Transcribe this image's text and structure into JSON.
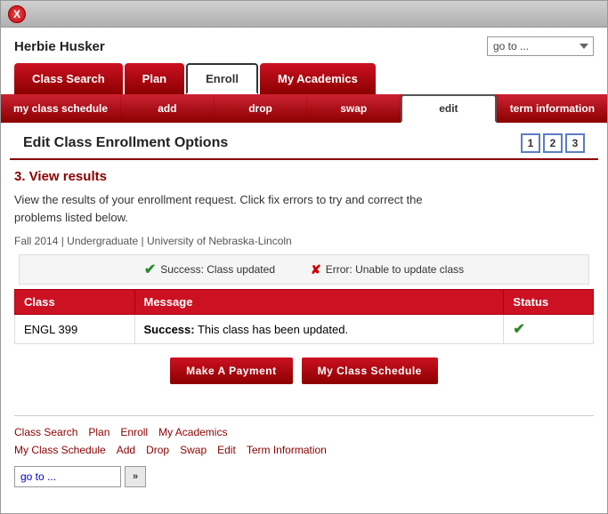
{
  "window": {
    "close_button": "X"
  },
  "header": {
    "user_name": "Herbie Husker",
    "goto_label": "go to ...",
    "goto_placeholder": "go to ..."
  },
  "main_nav": {
    "tabs": [
      {
        "id": "class-search",
        "label": "Class Search",
        "active": false
      },
      {
        "id": "plan",
        "label": "Plan",
        "active": false
      },
      {
        "id": "enroll",
        "label": "Enroll",
        "active": true
      },
      {
        "id": "my-academics",
        "label": "My Academics",
        "active": false
      }
    ]
  },
  "sub_nav": {
    "tabs": [
      {
        "id": "my-class-schedule",
        "label": "my class schedule",
        "active": false
      },
      {
        "id": "add",
        "label": "add",
        "active": false
      },
      {
        "id": "drop",
        "label": "drop",
        "active": false
      },
      {
        "id": "swap",
        "label": "swap",
        "active": false
      },
      {
        "id": "edit",
        "label": "edit",
        "active": true
      },
      {
        "id": "term-information",
        "label": "term information",
        "active": false
      }
    ]
  },
  "page": {
    "title": "Edit Class Enrollment Options",
    "steps": [
      "1",
      "2",
      "3"
    ],
    "section_header": "3.  View results",
    "description_line1": "View the results of your enrollment request.  Click fix errors to try and correct the",
    "description_line2": "problems listed below.",
    "term_info": "Fall 2014 | Undergraduate | University of Nebraska-Lincoln"
  },
  "status_bar": {
    "success_label": "Success:  Class updated",
    "error_label": "Error: Unable to update class"
  },
  "results_table": {
    "headers": [
      "Class",
      "Message",
      "Status"
    ],
    "rows": [
      {
        "class": "ENGL  399",
        "message_bold": "Success:",
        "message_text": " This class has been updated.",
        "status": "✓"
      }
    ]
  },
  "buttons": {
    "make_payment": "Make A Payment",
    "my_class_schedule": "My Class Schedule"
  },
  "footer": {
    "links_row1": [
      {
        "id": "class-search",
        "label": "Class Search"
      },
      {
        "id": "plan",
        "label": "Plan"
      },
      {
        "id": "enroll",
        "label": "Enroll"
      },
      {
        "id": "my-academics",
        "label": "My Academics"
      }
    ],
    "links_row2": [
      {
        "id": "my-class-schedule",
        "label": "My Class Schedule"
      },
      {
        "id": "add",
        "label": "Add"
      },
      {
        "id": "drop",
        "label": "Drop"
      },
      {
        "id": "swap",
        "label": "Swap"
      },
      {
        "id": "edit",
        "label": "Edit"
      },
      {
        "id": "term-information",
        "label": "Term Information"
      }
    ],
    "goto_label": "go to",
    "goto_dots": "...",
    "arrow_label": "»"
  }
}
